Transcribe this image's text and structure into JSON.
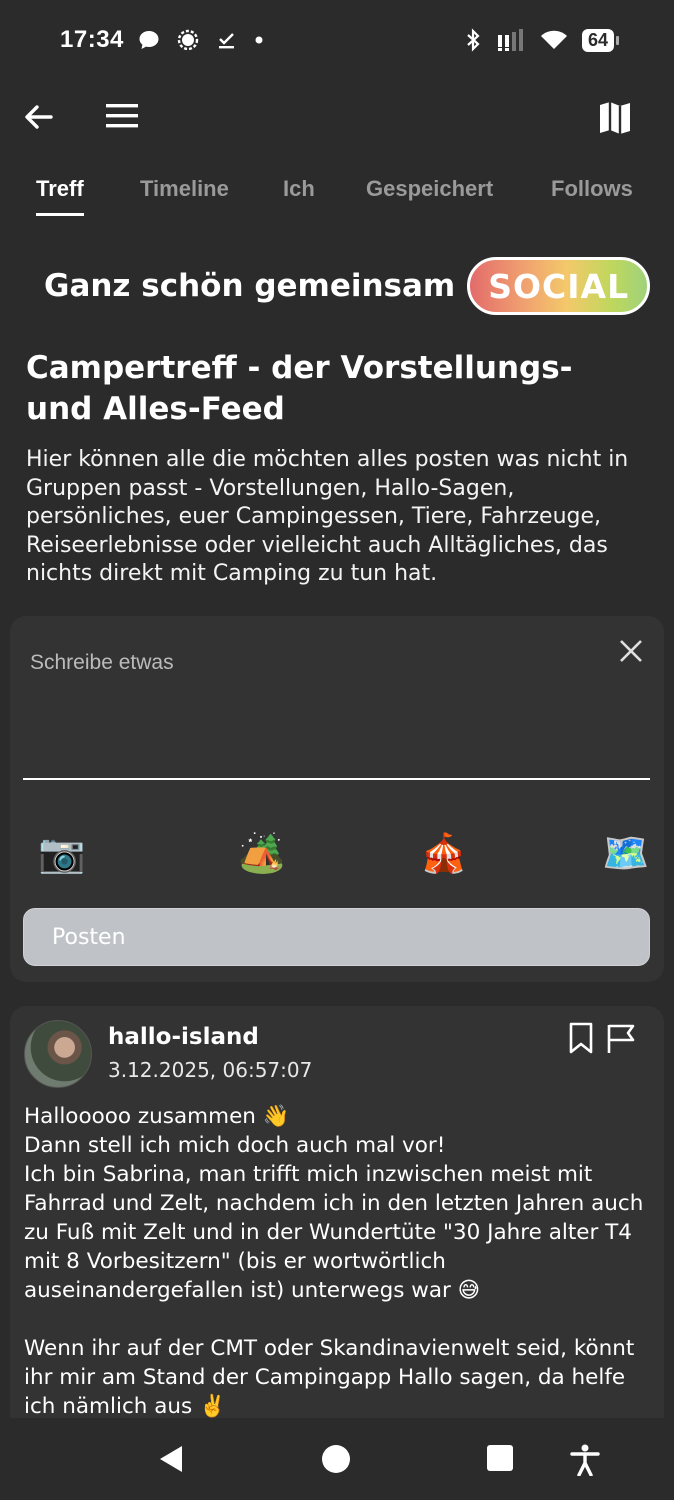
{
  "status_bar": {
    "time": "17:34",
    "battery": "64",
    "icons": [
      "message-icon",
      "signal-app-icon",
      "check-icon",
      "dot-icon",
      "bluetooth-icon",
      "cell-signal-icon",
      "wifi-icon",
      "battery-icon"
    ]
  },
  "app_bar": {
    "icons": [
      "back-arrow-icon",
      "menu-icon",
      "map-icon"
    ]
  },
  "tabs": [
    {
      "label": "Treff",
      "active": true
    },
    {
      "label": "Timeline",
      "active": false
    },
    {
      "label": "Ich",
      "active": false
    },
    {
      "label": "Gespeichert",
      "active": false
    },
    {
      "label": "Follows",
      "active": false
    }
  ],
  "hero": {
    "title": "Ganz schön gemeinsam",
    "badge": "SOCIAL"
  },
  "feed": {
    "heading": "Campertreff - der Vorstellungs- und Alles-Feed",
    "description": "Hier können alle die möchten alles posten was nicht in Gruppen passt - Vorstellungen, Hallo-Sagen, persönliches, euer Campingessen, Tiere, Fahrzeuge, Reiseerlebnisse oder vielleicht auch Alltägliches, das nichts direkt mit Camping zu tun hat."
  },
  "composer": {
    "placeholder": "Schreibe etwas",
    "attachments": [
      "📷",
      "🏕️",
      "🎪",
      "🗺️"
    ],
    "post_label": "Posten"
  },
  "post": {
    "author": "hallo-island",
    "date": "3.12.2025, 06:57:07",
    "body": "Hallooooo zusammen 👋\nDann stell ich mich doch auch mal vor!\nIch bin Sabrina, man trifft mich inzwischen meist mit Fahrrad und Zelt, nachdem ich in den letzten Jahren auch zu Fuß mit Zelt und in der Wundertüte \"30 Jahre alter T4 mit 8 Vorbesitzern\" (bis er wortwörtlich auseinandergefallen ist) unterwegs war 😅\n\nWenn ihr auf der CMT oder Skandinavienwelt seid, könnt ihr mir am Stand der Campingapp Hallo sagen, da helfe ich nämlich aus ✌️"
  }
}
